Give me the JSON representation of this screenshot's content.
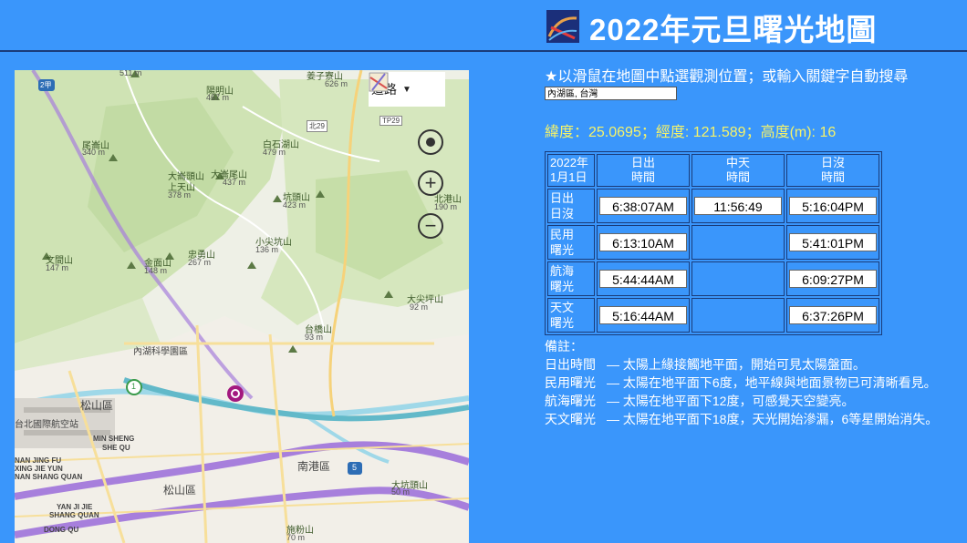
{
  "header": {
    "title": "2022年元旦曙光地圖"
  },
  "map": {
    "view_button_label": "道路",
    "search_value": "內湖區, 台灣",
    "places": [
      {
        "name": "511 m"
      },
      {
        "name": "陽明山"
      },
      {
        "name": "467 m"
      },
      {
        "name": "姜子寮山"
      },
      {
        "name": "626 m"
      },
      {
        "name": "尾崙山"
      },
      {
        "name": "340 m"
      },
      {
        "name": "大崙頭山"
      },
      {
        "name": "上天山"
      },
      {
        "name": "378 m"
      },
      {
        "name": "大崙尾山"
      },
      {
        "name": "437 m"
      },
      {
        "name": "白石湖山"
      },
      {
        "name": "479 m"
      },
      {
        "name": "坑頭山"
      },
      {
        "name": "423 m"
      },
      {
        "name": "北港山"
      },
      {
        "name": "190 m"
      },
      {
        "name": "小尖坑山"
      },
      {
        "name": "136 m"
      },
      {
        "name": "忠勇山"
      },
      {
        "name": "267 m"
      },
      {
        "name": "金面山"
      },
      {
        "name": "148 m"
      },
      {
        "name": "文間山"
      },
      {
        "name": "147 m"
      },
      {
        "name": "大尖坪山"
      },
      {
        "name": "92 m"
      },
      {
        "name": "台橋山"
      },
      {
        "name": "93 m"
      },
      {
        "name": "內湖科學園區"
      },
      {
        "name": "松山區"
      },
      {
        "name": "台北國際航空站"
      },
      {
        "name": "MIN SHENG"
      },
      {
        "name": "SHE QU"
      },
      {
        "name": "NAN JING FU"
      },
      {
        "name": "XING JIE YUN"
      },
      {
        "name": "NAN SHANG QUAN"
      },
      {
        "name": "南港區"
      },
      {
        "name": "松山區"
      },
      {
        "name": "YAN JI JIE"
      },
      {
        "name": "SHANG QUAN"
      },
      {
        "name": "DONG QU"
      },
      {
        "name": "施粉山"
      },
      {
        "name": "70 m"
      },
      {
        "name": "大坑頭山"
      },
      {
        "name": "50 m"
      },
      {
        "name": "北29"
      },
      {
        "name": "TP29"
      },
      {
        "name": "2甲"
      },
      {
        "name": "5"
      },
      {
        "name": "1"
      }
    ]
  },
  "panel": {
    "instructions": "★以滑鼠在地圖中點選觀測位置；或輸入關鍵字自動搜尋",
    "coords": "緯度：25.0695；經度: 121.589；高度(m): 16",
    "table": {
      "corner": [
        "2022年",
        "1月1日"
      ],
      "columns": [
        {
          "l1": "日出",
          "l2": "時間"
        },
        {
          "l1": "中天",
          "l2": "時間"
        },
        {
          "l1": "日沒",
          "l2": "時間"
        }
      ],
      "rows": [
        {
          "h1": "日出",
          "h2": "日沒",
          "vals": [
            "6:38:07AM",
            "11:56:49",
            "5:16:04PM"
          ]
        },
        {
          "h1": "民用",
          "h2": "曙光",
          "vals": [
            "6:13:10AM",
            "",
            "5:41:01PM"
          ]
        },
        {
          "h1": "航海",
          "h2": "曙光",
          "vals": [
            "5:44:44AM",
            "",
            "6:09:27PM"
          ]
        },
        {
          "h1": "天文",
          "h2": "曙光",
          "vals": [
            "5:16:44AM",
            "",
            "6:37:26PM"
          ]
        }
      ]
    },
    "notes": {
      "heading": "備註：",
      "items": [
        {
          "label": "日出時間",
          "text": "— 太陽上緣接觸地平面，開始可見太陽盤面。"
        },
        {
          "label": "民用曙光",
          "text": "— 太陽在地平面下6度，地平線與地面景物已可清晰看見。"
        },
        {
          "label": "航海曙光",
          "text": "— 太陽在地平面下12度，可感覺天空變亮。"
        },
        {
          "label": "天文曙光",
          "text": "— 太陽在地平面下18度，天光開始滲漏，6等星開始消失。"
        }
      ]
    }
  }
}
